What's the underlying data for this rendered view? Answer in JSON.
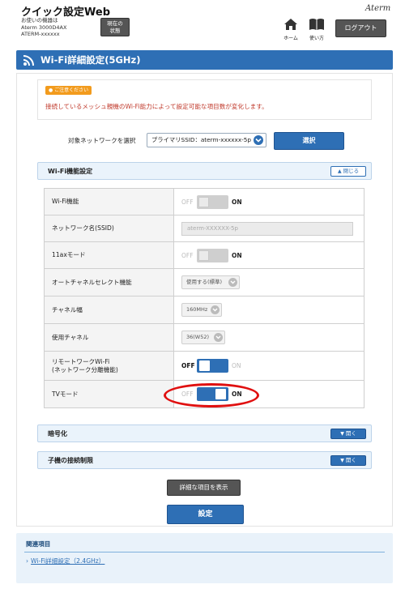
{
  "header": {
    "app_title": "クイック設定Web",
    "device_info_label": "お使いの機器は",
    "device_model": "Aterm 3000D4AX",
    "device_ssid": "ATERM-xxxxxx",
    "status_button": [
      "現在の",
      "状態"
    ],
    "brand_logo": "Aterm",
    "home_label": "ホーム",
    "usage_label": "使い方",
    "logout_label": "ログアウト"
  },
  "page": {
    "title": "Wi-Fi詳細設定(5GHz)"
  },
  "notice": {
    "badge": "ご注意ください",
    "text": "接続しているメッシュ親機のWi-Fi能力によって設定可能な項目数が変化します。"
  },
  "network_select": {
    "label": "対象ネットワークを選択",
    "selected": "プライマリSSID：aterm-xxxxxx-5p",
    "button": "選択"
  },
  "wifi_section": {
    "title": "Wi-Fi機能設定",
    "toggle_label": "閉じる",
    "rows": [
      {
        "label": "Wi-Fi機能",
        "off": "OFF",
        "on": "ON"
      },
      {
        "label": "ネットワーク名(SSID)",
        "value": "aterm-XXXXXX-5p"
      },
      {
        "label": "11axモード",
        "off": "OFF",
        "on": "ON"
      },
      {
        "label": "オートチャネルセレクト機能",
        "value": "使用する(標準)"
      },
      {
        "label": "チャネル幅",
        "value": "160MHz"
      },
      {
        "label": "使用チャネル",
        "value": "36(W52)"
      },
      {
        "label_line1": "リモートワークWi-Fi",
        "label_line2": "(ネットワーク分離機能)",
        "off": "OFF",
        "on": "ON"
      },
      {
        "label": "TVモード",
        "off": "OFF",
        "on": "ON"
      }
    ]
  },
  "encryption_section": {
    "title": "暗号化",
    "toggle_label": "開く"
  },
  "child_section": {
    "title": "子機の接続制限",
    "toggle_label": "開く"
  },
  "buttons": {
    "show_details": "詳細な項目を表示",
    "apply": "設定"
  },
  "related": {
    "title": "関連項目",
    "link": "Wi-Fi詳細設定（2.4GHz）"
  },
  "colors": {
    "accent": "#2e6fb5",
    "notice_orange": "#f29b1d",
    "notice_red": "#c0392b",
    "highlight_red": "#e01010"
  }
}
